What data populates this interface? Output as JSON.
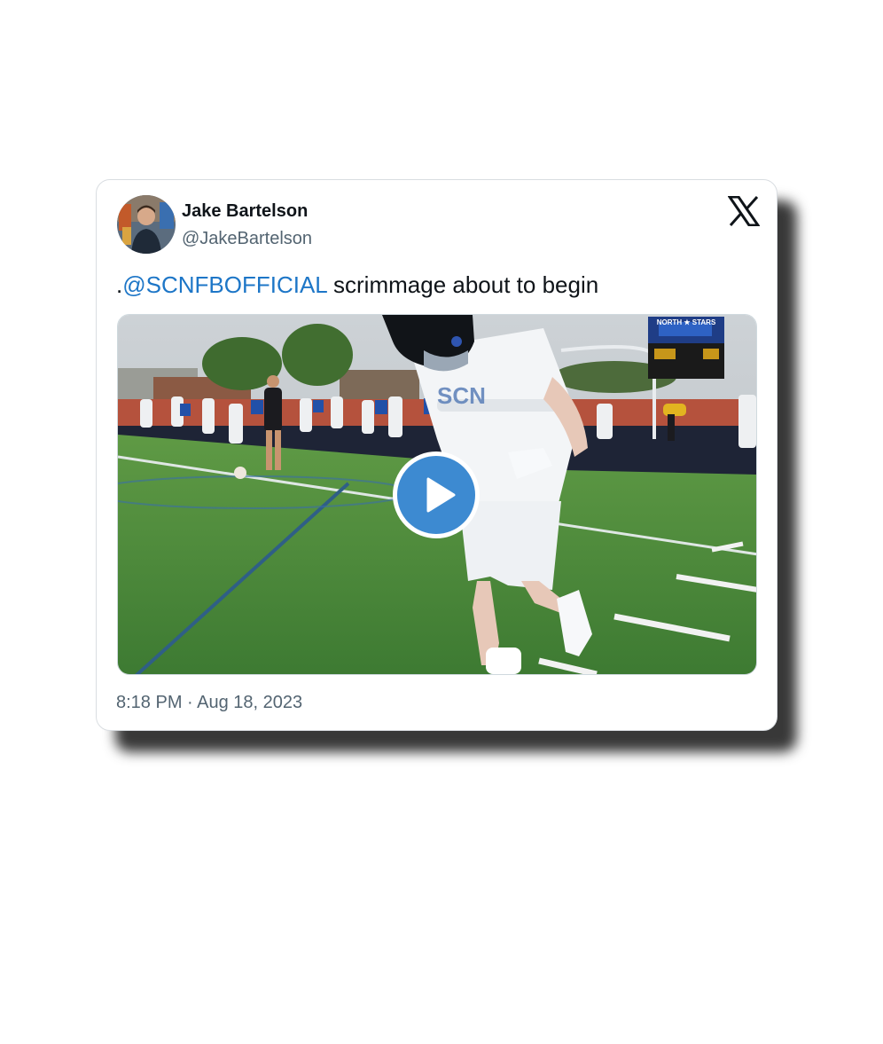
{
  "tweet": {
    "author": {
      "display_name": "Jake Bartelson",
      "handle": "@JakeBartelson",
      "avatar_icon": "profile-photo"
    },
    "text": {
      "prefix": ".",
      "mention": "@SCNFBOFFICIAL",
      "rest": " scrimmage about to begin"
    },
    "media": {
      "type": "video",
      "play_icon": "play-icon",
      "scoreboard_header": "NORTH ★ STARS"
    },
    "timestamp": "8:18 PM · Aug 18, 2023",
    "platform_icon": "x-logo-icon"
  },
  "colors": {
    "mention": "#1d76c7",
    "play_button": "#3d8ad1",
    "text_primary": "#0f1419",
    "text_secondary": "#536471",
    "field_green": "#4a8a3c"
  }
}
